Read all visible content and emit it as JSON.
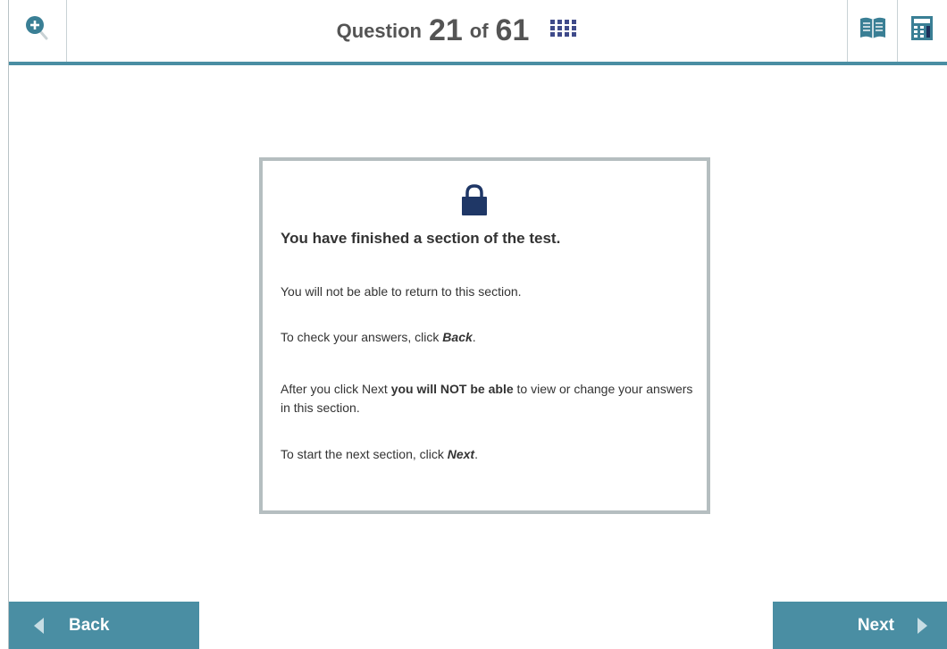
{
  "header": {
    "question_prefix": "Question",
    "current_question": "21",
    "question_separator": "of",
    "total_questions": "61",
    "icons": [
      "zoom-in-icon",
      "question-grid-icon",
      "reference-book-icon",
      "calculator-icon"
    ],
    "accent_color": "#4a8ea3"
  },
  "dialog": {
    "icon": "lock-icon",
    "heading": "You have finished a section of the test.",
    "line1": "You will not be able to return to this section.",
    "line2_pre": "To check your answers, click ",
    "line2_link": "Back",
    "line2_post": ".",
    "line3_pre": "After you click Next ",
    "line3_bold": "you will NOT be able",
    "line3_post": " to view or change your answers in this section.",
    "line4_pre": "To start the next section, click ",
    "line4_link": "Next",
    "line4_post": "."
  },
  "footer": {
    "back_label": "Back",
    "next_label": "Next"
  }
}
